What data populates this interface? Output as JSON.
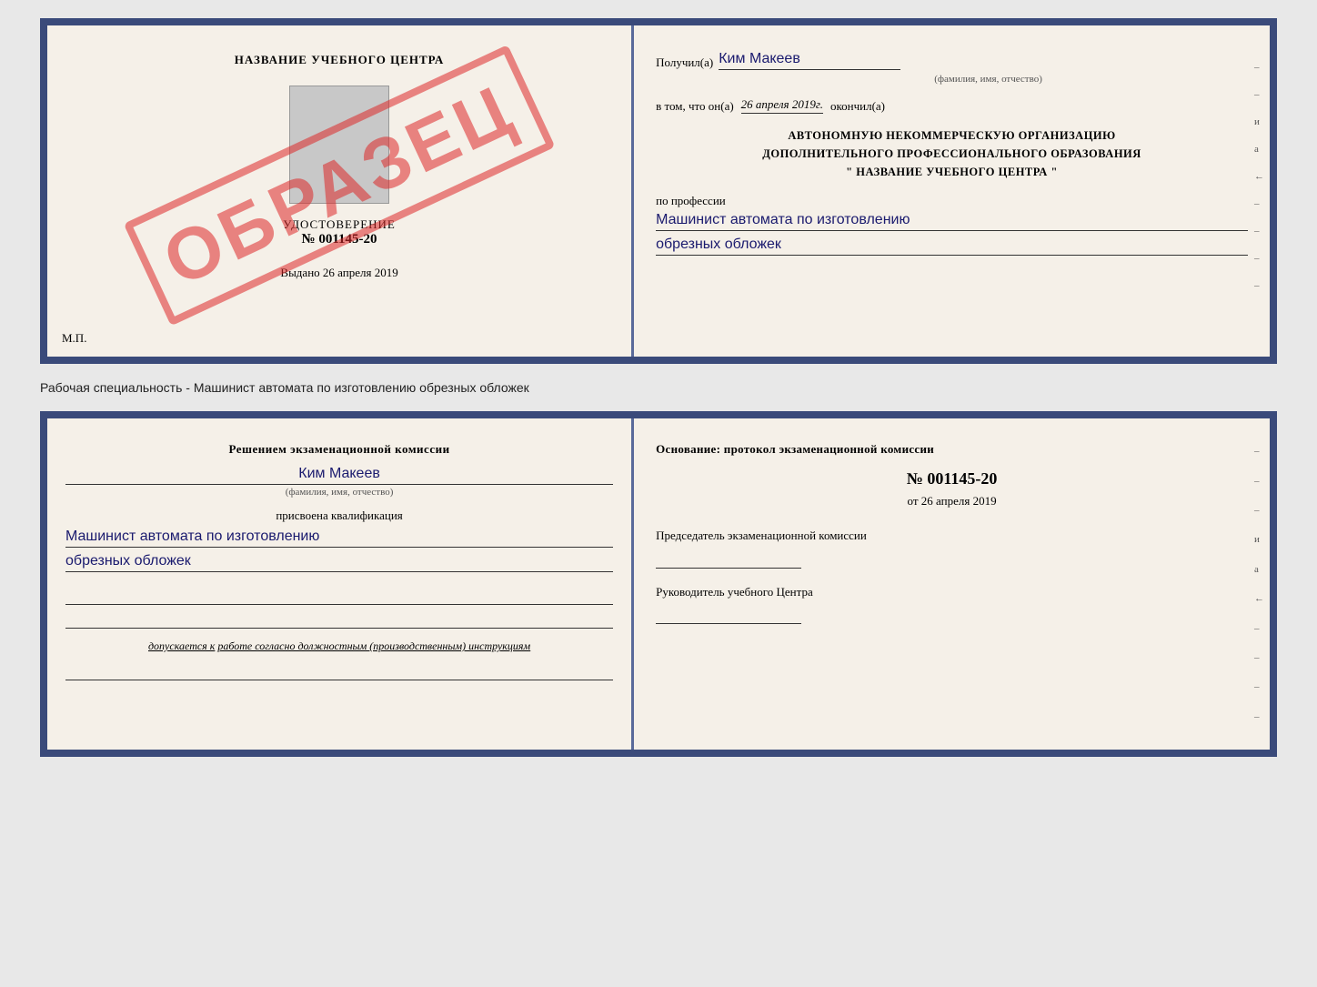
{
  "top_document": {
    "left": {
      "title": "НАЗВАНИЕ УЧЕБНОГО ЦЕНТРА",
      "watermark": "ОБРАЗЕЦ",
      "certificate_label": "УДОСТОВЕРЕНИЕ",
      "certificate_number": "№ 001145-20",
      "issued_label": "Выдано",
      "issued_date": "26 апреля 2019",
      "mp_label": "М.П."
    },
    "right": {
      "recipient_label": "Получил(а)",
      "recipient_name": "Ким Макеев",
      "recipient_subtitle": "(фамилия, имя, отчество)",
      "date_label": "в том, что он(а)",
      "date_value": "26 апреля 2019г.",
      "completed_label": "окончил(а)",
      "org_line1": "АВТОНОМНУЮ НЕКОММЕРЧЕСКУЮ ОРГАНИЗАЦИЮ",
      "org_line2": "ДОПОЛНИТЕЛЬНОГО ПРОФЕССИОНАЛЬНОГО ОБРАЗОВАНИЯ",
      "org_line3": "\"  НАЗВАНИЕ УЧЕБНОГО ЦЕНТРА  \"",
      "profession_label": "по профессии",
      "profession_line1": "Машинист автомата по изготовлению",
      "profession_line2": "обрезных обложек",
      "side_marks": [
        "–",
        "–",
        "и",
        "а",
        "←",
        "–",
        "–",
        "–",
        "–",
        "–"
      ]
    }
  },
  "caption": {
    "text": "Рабочая специальность - Машинист автомата по изготовлению обрезных обложек"
  },
  "bottom_document": {
    "left": {
      "decision_title": "Решением экзаменационной комиссии",
      "person_name": "Ким Макеев",
      "name_subtitle": "(фамилия, имя, отчество)",
      "qualification_label": "присвоена квалификация",
      "qualification_line1": "Машинист автомата по изготовлению",
      "qualification_line2": "обрезных обложек",
      "допускается_label": "допускается к",
      "допускается_value": "работе согласно должностным (производственным) инструкциям"
    },
    "right": {
      "basis_label": "Основание: протокол экзаменационной комиссии",
      "protocol_number": "№ 001145-20",
      "protocol_date_prefix": "от",
      "protocol_date": "26 апреля 2019",
      "chairman_title": "Председатель экзаменационной комиссии",
      "director_title": "Руководитель учебного Центра",
      "side_marks": [
        "–",
        "–",
        "–",
        "и",
        "а",
        "←",
        "–",
        "–",
        "–",
        "–",
        "–"
      ]
    }
  }
}
